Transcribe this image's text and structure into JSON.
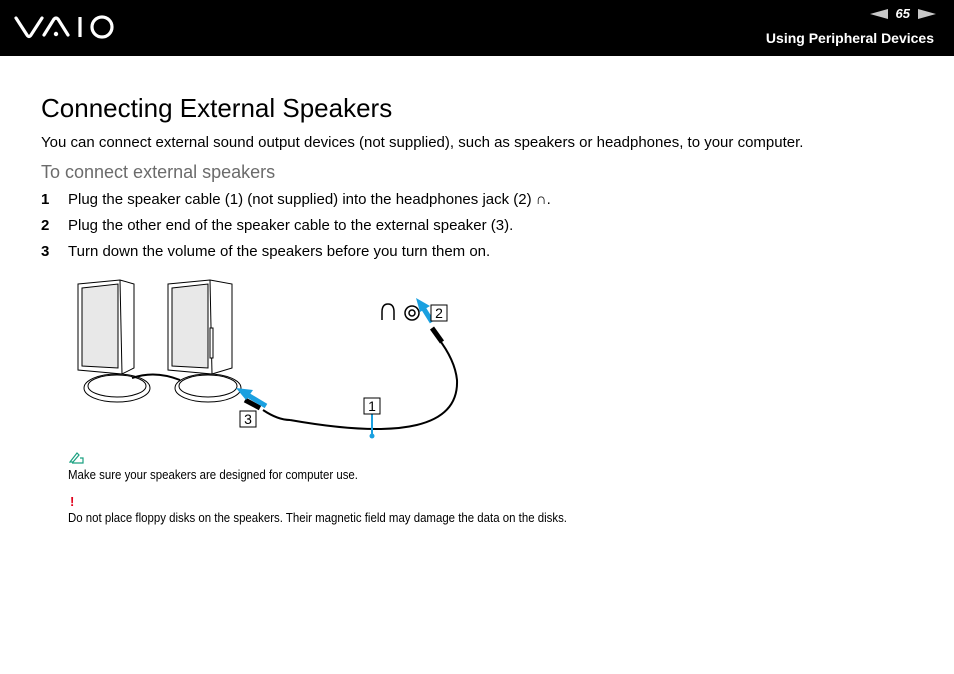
{
  "header": {
    "logo": "VAIO",
    "page_number": "65",
    "section_title": "Using Peripheral Devices"
  },
  "main": {
    "title": "Connecting External Speakers",
    "intro": "You can connect external sound output devices (not supplied), such as speakers or headphones, to your computer.",
    "procedure_title": "To connect external speakers",
    "steps": [
      {
        "num": "1",
        "text": "Plug the speaker cable (1) (not supplied) into the headphones jack (2) ∩."
      },
      {
        "num": "2",
        "text": "Plug the other end of the speaker cable to the external speaker (3)."
      },
      {
        "num": "3",
        "text": "Turn down the volume of the speakers before you turn them on."
      }
    ],
    "diagram": {
      "callouts": [
        "1",
        "2",
        "3"
      ],
      "accent_color": "#1aa0e0"
    },
    "note": {
      "icon": "pencil-note-icon",
      "text": "Make sure your speakers are designed for computer use."
    },
    "warning": {
      "icon": "!",
      "text": "Do not place floppy disks on the speakers. Their magnetic field may damage the data on the disks.",
      "color": "#e0001b"
    }
  }
}
